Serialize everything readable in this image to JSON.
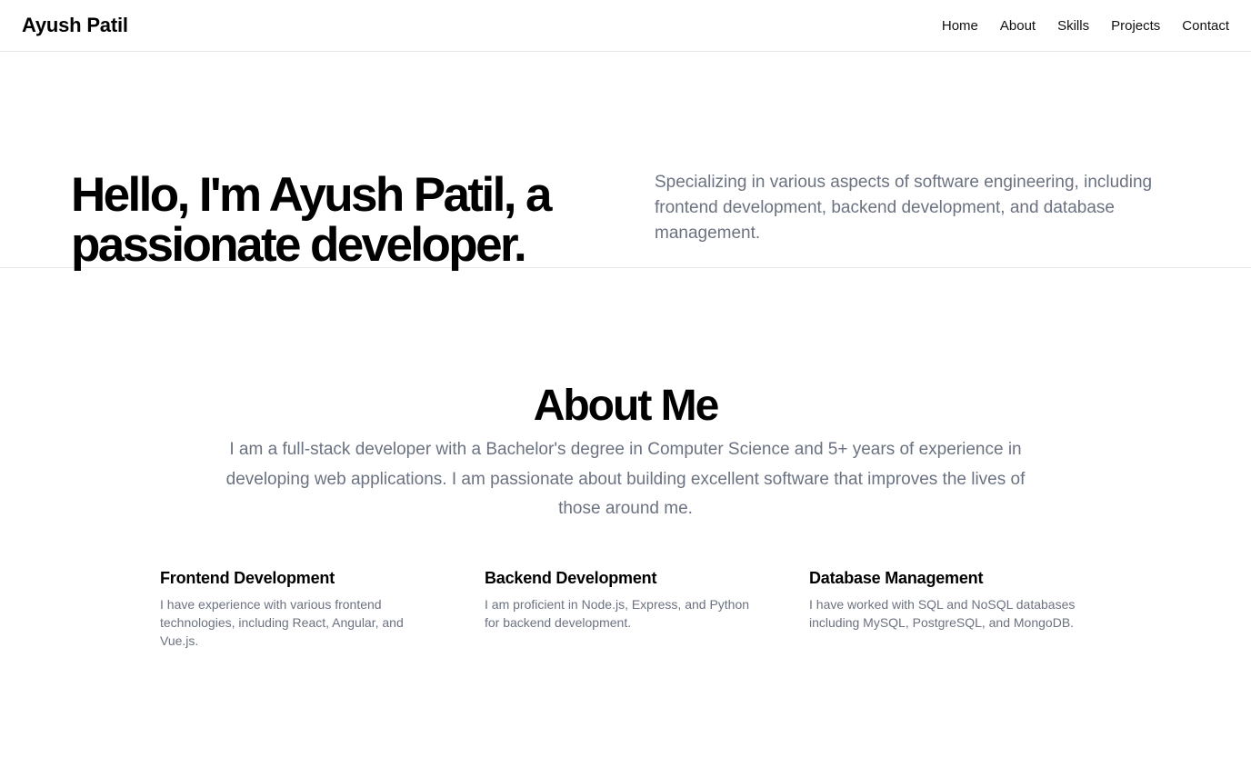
{
  "header": {
    "brand": "Ayush Patil",
    "nav": [
      {
        "label": "Home"
      },
      {
        "label": "About"
      },
      {
        "label": "Skills"
      },
      {
        "label": "Projects"
      },
      {
        "label": "Contact"
      }
    ]
  },
  "hero": {
    "title": "Hello, I'm Ayush Patil, a passionate developer.",
    "subtitle": "Specializing in various aspects of software engineering, including frontend development, backend development, and database management."
  },
  "about": {
    "title": "About Me",
    "text": "I am a full-stack developer with a Bachelor's degree in Computer Science and 5+ years of experience in developing web applications. I am passionate about building excellent software that improves the lives of those around me.",
    "features": [
      {
        "title": "Frontend Development",
        "text": "I have experience with various frontend technologies, including React, Angular, and Vue.js."
      },
      {
        "title": "Backend Development",
        "text": "I am proficient in Node.js, Express, and Python for backend development."
      },
      {
        "title": "Database Management",
        "text": "I have worked with SQL and NoSQL databases including MySQL, PostgreSQL, and MongoDB."
      }
    ]
  },
  "colors": {
    "text_primary": "#000000",
    "text_muted": "#6b7280",
    "border": "#e5e7eb",
    "background": "#ffffff"
  }
}
